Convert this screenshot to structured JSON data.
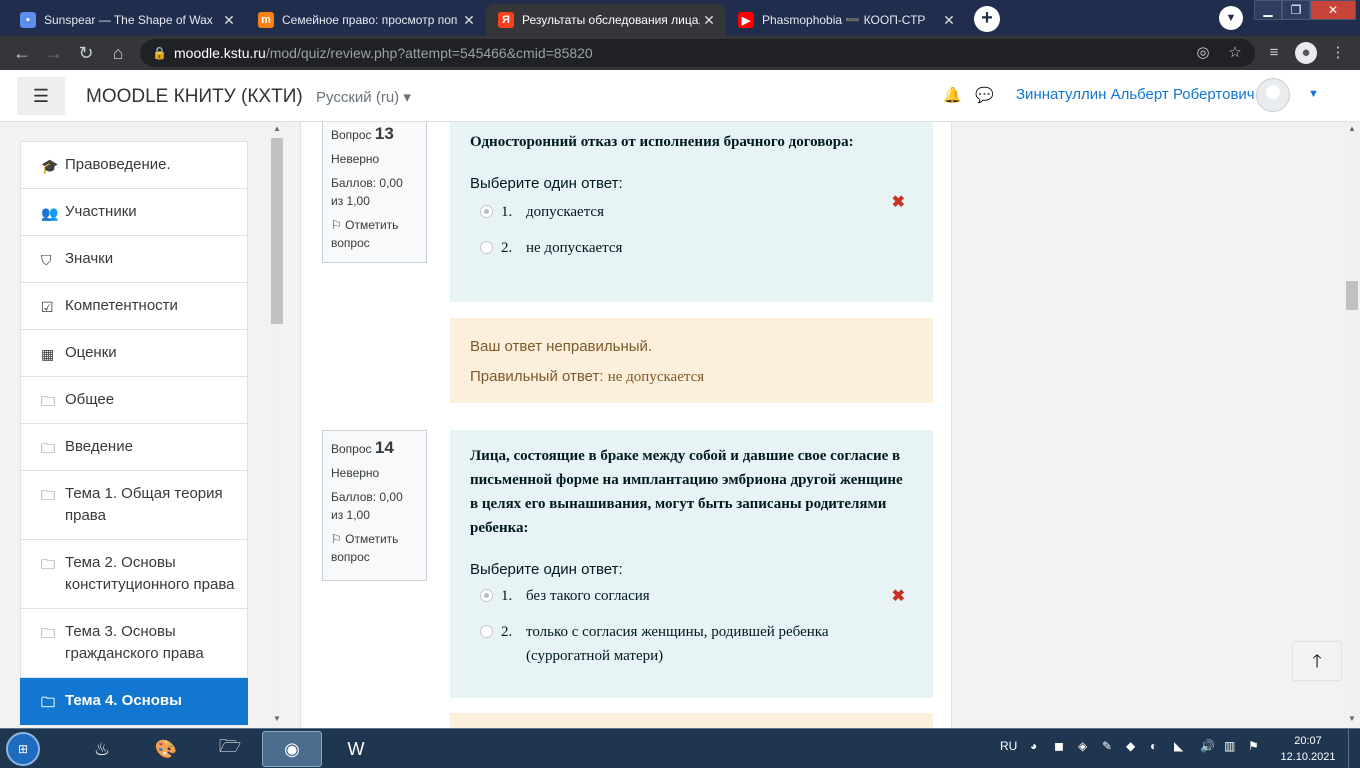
{
  "browser": {
    "tabs": [
      {
        "title": "Sunspear — The Shape of Wax",
        "icon": "chat-icon",
        "color": "#5b8def"
      },
      {
        "title": "Семейное право: просмотр поп",
        "icon": "moodle-icon",
        "color": "#f98012"
      },
      {
        "title": "Результаты обследования лица,",
        "icon": "yandex-icon",
        "color": "#fc3f1d"
      },
      {
        "title": "Phasmophobia ➖ КООП-СТР",
        "icon": "youtube-icon",
        "color": "#ff0000"
      }
    ],
    "url_host": "moodle.kstu.ru",
    "url_path": "/mod/quiz/review.php?attempt=545466&cmid=85820"
  },
  "header": {
    "site_name": "MOODLE КНИТУ (КХТИ)",
    "language": "Русский (ru)",
    "user_name": "Зиннатуллин Альберт Робертович"
  },
  "sidebar": {
    "items": [
      {
        "label": "Правоведение.",
        "icon": "graduation-cap-icon"
      },
      {
        "label": "Участники",
        "icon": "users-icon"
      },
      {
        "label": "Значки",
        "icon": "shield-icon"
      },
      {
        "label": "Компетентности",
        "icon": "checkbox-icon"
      },
      {
        "label": "Оценки",
        "icon": "table-icon"
      },
      {
        "label": "Общее",
        "icon": "folder-icon"
      },
      {
        "label": "Введение",
        "icon": "folder-icon"
      },
      {
        "label": "Тема 1. Общая теория права",
        "icon": "folder-icon"
      },
      {
        "label": "Тема 2. Основы конституционного права",
        "icon": "folder-icon"
      },
      {
        "label": "Тема 3. Основы гражданского права",
        "icon": "folder-icon"
      },
      {
        "label": "Тема 4. Основы",
        "icon": "folder-icon"
      }
    ]
  },
  "questions": [
    {
      "label": "Вопрос",
      "number": "13",
      "state": "Неверно",
      "score": "Баллов: 0,00 из 1,00",
      "flag": "Отметить вопрос",
      "text": "Односторонний отказ от исполнения брачного договора:",
      "prompt": "Выберите один ответ:",
      "options": [
        {
          "num": "1.",
          "text": "допускается",
          "selected": true
        },
        {
          "num": "2.",
          "text": "не допускается",
          "selected": false
        }
      ],
      "feedback_incorrect": "Ваш ответ неправильный.",
      "feedback_correct_label": "Правильный ответ:",
      "feedback_correct_answer": "не допускается"
    },
    {
      "label": "Вопрос",
      "number": "14",
      "state": "Неверно",
      "score": "Баллов: 0,00 из 1,00",
      "flag": "Отметить вопрос",
      "text": "Лица, состоящие в браке между собой и давшие свое согласие в письменной форме на имплантацию эмбриона другой женщине в целях его вынашивания, могут быть записаны родителями ребенка:",
      "prompt": "Выберите один ответ:",
      "options": [
        {
          "num": "1.",
          "text": "без такого согласия",
          "selected": true
        },
        {
          "num": "2.",
          "text": "только с согласия женщины, родившей ребенка (суррогатной матери)",
          "selected": false
        }
      ]
    }
  ],
  "taskbar": {
    "language": "RU",
    "time": "20:07",
    "date": "12.10.2021"
  }
}
